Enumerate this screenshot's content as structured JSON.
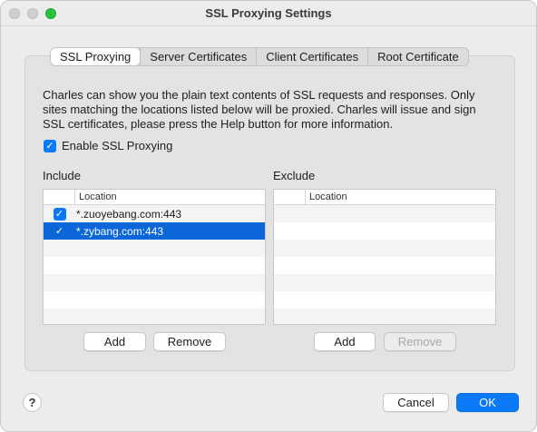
{
  "window": {
    "title": "SSL Proxying Settings"
  },
  "tabs": [
    {
      "label": "SSL Proxying",
      "active": true
    },
    {
      "label": "Server Certificates",
      "active": false
    },
    {
      "label": "Client Certificates",
      "active": false
    },
    {
      "label": "Root Certificate",
      "active": false
    }
  ],
  "description": "Charles can show you the plain text contents of SSL requests and responses. Only sites matching the locations listed below will be proxied. Charles will issue and sign SSL certificates, please press the Help button for more information.",
  "enable_checkbox": {
    "label": "Enable SSL Proxying",
    "checked": true
  },
  "include": {
    "label": "Include",
    "column_header": "Location",
    "rows": [
      {
        "location": "*.zuoyebang.com:443",
        "checked": true,
        "selected": false
      },
      {
        "location": "*.zybang.com:443",
        "checked": true,
        "selected": true
      }
    ],
    "add_label": "Add",
    "remove_label": "Remove"
  },
  "exclude": {
    "label": "Exclude",
    "column_header": "Location",
    "rows": [],
    "add_label": "Add",
    "remove_label": "Remove"
  },
  "footer": {
    "help_label": "?",
    "cancel_label": "Cancel",
    "ok_label": "OK"
  },
  "colors": {
    "accent": "#0a79f7",
    "selection": "#0b67d9"
  }
}
